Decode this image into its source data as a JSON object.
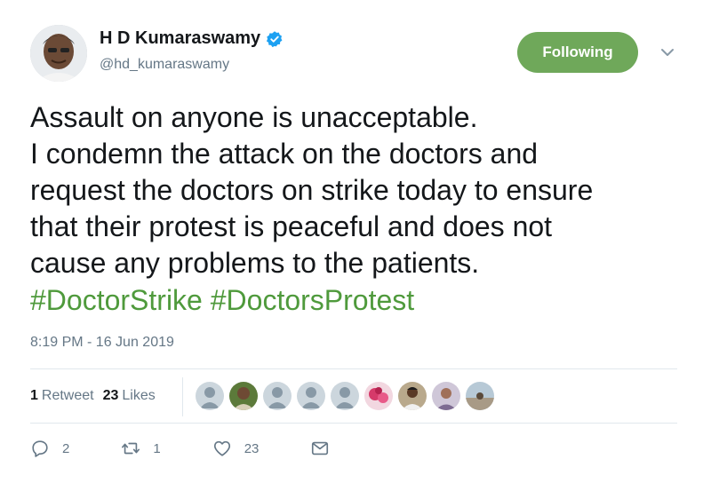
{
  "user": {
    "name": "H D Kumaraswamy",
    "handle": "@hd_kumaraswamy",
    "verified": true,
    "avatar_icon": "profile-photo"
  },
  "follow_button": {
    "label": "Following",
    "color": "#6fa85a"
  },
  "tweet": {
    "text": "Assault on anyone is unacceptable.\nI condemn the attack on the doctors and\nrequest the doctors on strike today to ensure\nthat their protest is peaceful and does not\ncause any problems to the patients.",
    "hashtags": [
      "#DoctorStrike",
      "#DoctorsProtest"
    ],
    "timestamp": "8:19 PM - 16 Jun 2019"
  },
  "stats": {
    "retweets_count": "1",
    "retweets_label": "Retweet",
    "likes_count": "23",
    "likes_label": "Likes"
  },
  "actions": {
    "reply_count": "2",
    "retweet_count": "1",
    "like_count": "23"
  },
  "colors": {
    "hashtag": "#4f9a3c",
    "muted": "#657786",
    "verified_badge": "#1da1f2"
  }
}
